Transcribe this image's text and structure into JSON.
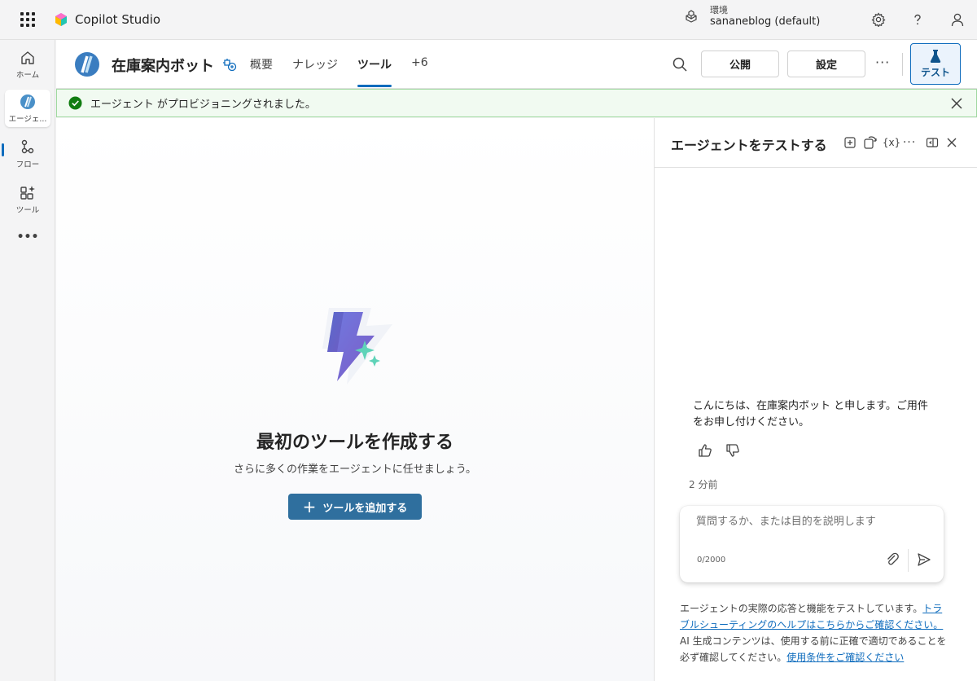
{
  "topbar": {
    "app_name": "Copilot Studio",
    "env_label": "環境",
    "env_value": "sananeblog (default)",
    "icons": [
      "app-launcher-icon",
      "settings-icon",
      "help-icon",
      "account-icon"
    ]
  },
  "rail": {
    "items": [
      {
        "label": "ホーム",
        "icon": "home-icon"
      },
      {
        "label": "エージェ...",
        "icon": "agent-icon"
      },
      {
        "label": "フロー",
        "icon": "flow-icon"
      },
      {
        "label": "ツール",
        "icon": "tools-icon"
      }
    ],
    "more": "•••"
  },
  "header": {
    "agent_name": "在庫案内ボット",
    "tabs": [
      {
        "label": "概要"
      },
      {
        "label": "ナレッジ"
      },
      {
        "label": "ツール"
      },
      {
        "label": "+6"
      }
    ],
    "active_tab": "ツール",
    "publish_label": "公開",
    "settings_label": "設定",
    "more_label": "···",
    "test_label": "テスト"
  },
  "notification": {
    "text": "エージェント がプロビジョニングされました。",
    "status_color": "#107c10"
  },
  "main": {
    "title": "最初のツールを作成する",
    "subtitle": "さらに多くの作業をエージェントに任せましょう。",
    "add_label": "ツールを追加する",
    "add_icon": "+"
  },
  "panel": {
    "title": "エージェントをテストする",
    "variables_label": "{x}",
    "more_label": "···",
    "message": "こんにちは、在庫案内ボット と申します。ご用件をお申し付けください。",
    "time": "2 分前",
    "input_placeholder": "質問するか、または目的を説明します",
    "char_count": "0/2000",
    "disclaimer_1": "エージェントの実際の応答と機能をテストしています。",
    "disclaimer_link_1": "トラブルシューティングのヘルプはこちらからご確認ください。",
    "disclaimer_2": "AI 生成コンテンツは、使用する前に正確で適切であることを必ず確認してください。",
    "disclaimer_link_2": "使用条件をご確認ください"
  },
  "colors": {
    "accent": "#0f6cbd",
    "primary_button": "#2f6f9e",
    "success_bg": "#f1faf1"
  }
}
